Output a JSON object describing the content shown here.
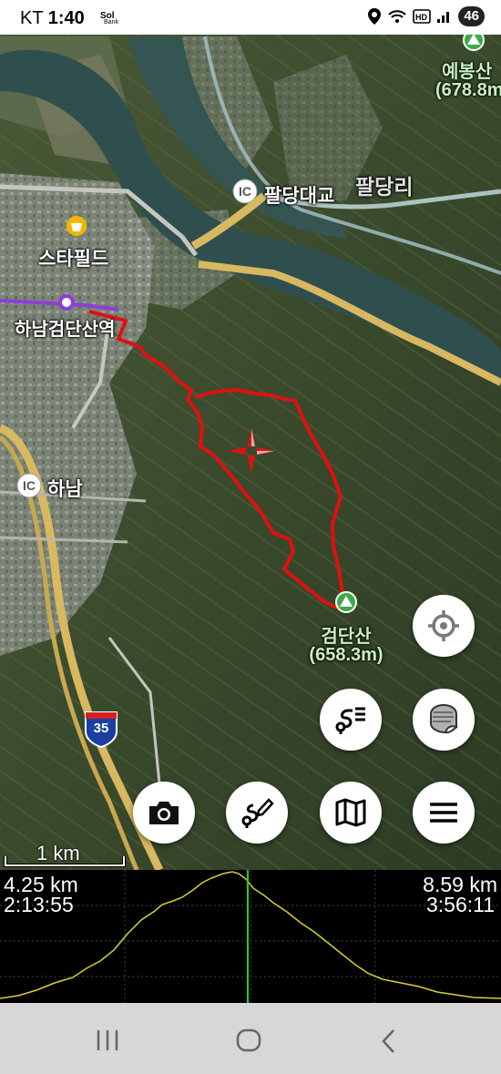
{
  "status_bar": {
    "carrier": "KT",
    "time": "1:40",
    "bank_app_label": "Bank",
    "battery": "46"
  },
  "map": {
    "places": [
      {
        "name": "팔당대교",
        "kind": "interchange"
      },
      {
        "name": "팔당리",
        "kind": "village"
      },
      {
        "name": "스타필드",
        "kind": "poi"
      },
      {
        "name": "하남검단산역",
        "kind": "station"
      },
      {
        "name": "하남",
        "kind": "interchange"
      }
    ],
    "peaks": [
      {
        "name": "예봉산",
        "elevation": "(678.8m"
      },
      {
        "name": "검단산",
        "elevation": "(658.3m)"
      }
    ],
    "interchange_badge": "IC",
    "highway_number": "35",
    "scale_bar": "1 km",
    "colors": {
      "track": "#e01010",
      "subway_line": "#8b3fd8",
      "road": "#d8b860"
    }
  },
  "buttons": {
    "locate": "crosshair-icon",
    "track_list": "route-list-icon",
    "map_layer": "layer-page-icon",
    "camera": "camera-icon",
    "route_edit": "route-edit-icon",
    "map": "map-icon",
    "menu": "hamburger-menu-icon"
  },
  "elevation_profile": {
    "left_distance": "4.25 km",
    "left_time": "2:13:55",
    "right_distance": "8.59 km",
    "right_time": "3:56:11",
    "cursor_fraction": 0.4945,
    "line_color": "#d8d030",
    "cursor_color": "#20d020"
  },
  "nav_bar": {
    "recent": "recent-apps-icon",
    "home": "home-icon",
    "back": "back-icon"
  }
}
